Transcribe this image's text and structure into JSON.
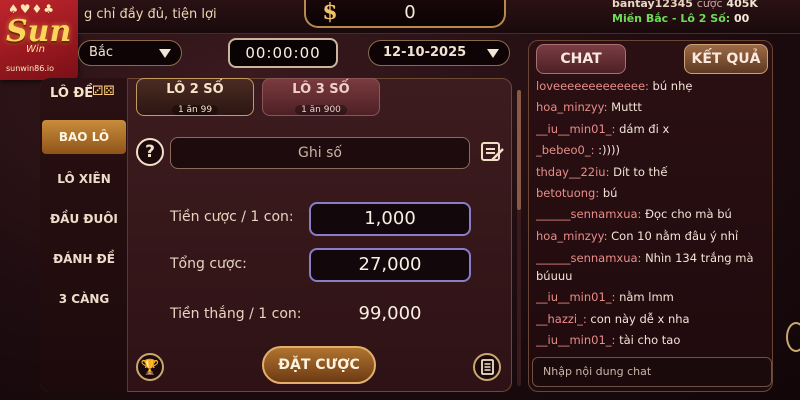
{
  "brand": {
    "suits": "♠♥♦♣",
    "logo": "Sun",
    "sub": "Win",
    "url": "sunwin86.io"
  },
  "topbar": {
    "tagline": "g chỉ đầy đủ, tiện lợi",
    "coin_symbol": "$",
    "balance": "0",
    "user": "bantay12345",
    "user_action": "cược",
    "user_amount": "405K",
    "region_label": "Miền Bắc - Lô 2 Số:",
    "region_value": "00"
  },
  "filters": {
    "region_select": "Bắc",
    "timer": "00:00:00",
    "date": "12-10-2025"
  },
  "sidebar": {
    "title": "LÔ ĐỀ",
    "dice": "⚂⚄",
    "items": [
      {
        "label": "BAO LÔ",
        "active": true
      },
      {
        "label": "LÔ XIÊN"
      },
      {
        "label": "ĐẦU ĐUÔI"
      },
      {
        "label": "ĐÁNH ĐỀ"
      },
      {
        "label": "3 CÀNG"
      }
    ]
  },
  "tabs": [
    {
      "label": "LÔ 2 SỐ",
      "sub": "1 ăn 99",
      "active": true
    },
    {
      "label": "LÔ 3 SỐ",
      "sub": "1 ăn 900"
    }
  ],
  "bet": {
    "help": "?",
    "note_placeholder": "Ghi số",
    "stake_label": "Tiền cược / 1 con:",
    "stake_value": "1,000",
    "total_label": "Tổng cược:",
    "total_value": "27,000",
    "win_label": "Tiền thắng / 1 con:",
    "win_value": "99,000",
    "submit_label": "ĐẶT CƯỢC",
    "trophy": "🏆"
  },
  "chat": {
    "tab_chat": "CHAT",
    "tab_result": "KẾT QUẢ",
    "input_placeholder": "Nhập nội dung chat",
    "messages": [
      {
        "user": "loveeeeeeeeeeeee:",
        "text": "bú nhẹ"
      },
      {
        "user": "hoa_minzyy:",
        "text": "Muttt"
      },
      {
        "user": "__iu__min01_:",
        "text": "dám đi x"
      },
      {
        "user": "_bebeo0_:",
        "text": ":))))"
      },
      {
        "user": "thday__22iu:",
        "text": "Dít to thế"
      },
      {
        "user": "betotuong:",
        "text": "bú"
      },
      {
        "user": "______sennamxua:",
        "text": "Đọc cho mà bú"
      },
      {
        "user": "hoa_minzyy:",
        "text": "Con 10 nằm đâu ý nhỉ"
      },
      {
        "user": "______sennamxua:",
        "text": "Nhìn 134 trắng mà búuuu",
        "wrap": true
      },
      {
        "user": "__iu__min01_:",
        "text": "nằm lmm"
      },
      {
        "user": "__hazzi_:",
        "text": "con này dễ x nha"
      },
      {
        "user": "__iu__min01_:",
        "text": "tài cho tao"
      }
    ]
  },
  "colors": {
    "accent": "#c98d3c",
    "chat_user": "#e88d8a",
    "region": "#6fdc57"
  }
}
